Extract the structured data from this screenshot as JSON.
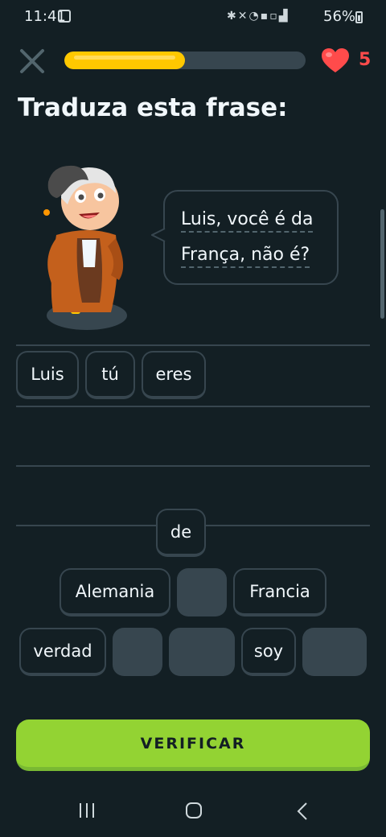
{
  "status_bar": {
    "time": "11:41",
    "icons": [
      "screenshot-icon",
      "bluetooth-icon",
      "mute-icon",
      "wifi-icon",
      "volte-icon",
      "5g-icon",
      "signal-icon"
    ],
    "battery": "56%",
    "battery_level": 0.56
  },
  "header": {
    "progress_fraction": 0.5,
    "progress_color": "#ffc800",
    "hearts": "5",
    "heart_color": "#ff4b4b"
  },
  "prompt": {
    "title": "Traduza esta frase:",
    "sentence_line1": "Luis, você é da",
    "sentence_line2": "França, não é?"
  },
  "answer": {
    "selected": [
      "Luis",
      "tú",
      "eres"
    ]
  },
  "word_bank": {
    "row1": [
      "de"
    ],
    "row2": [
      "Alemania",
      "",
      "Francia"
    ],
    "row3": [
      "verdad",
      "",
      "",
      "soy",
      ""
    ]
  },
  "actions": {
    "check_label": "VERIFICAR",
    "check_color": "#93d333"
  },
  "nav": [
    "recents-icon",
    "home-icon",
    "back-icon"
  ]
}
